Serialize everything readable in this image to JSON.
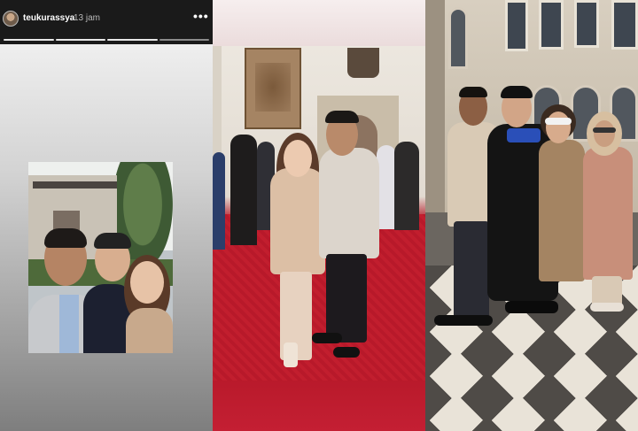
{
  "story": {
    "username": "teukurassya",
    "time": "13 jam",
    "more_icon": "•••",
    "progress_segments": [
      true,
      true,
      true,
      false
    ]
  },
  "panels": {
    "selfie": {
      "icon": "selfie-photo"
    },
    "hall": {
      "icon": "graduation-hall-photo"
    },
    "outdoor": {
      "icon": "family-outdoor-photo"
    }
  }
}
